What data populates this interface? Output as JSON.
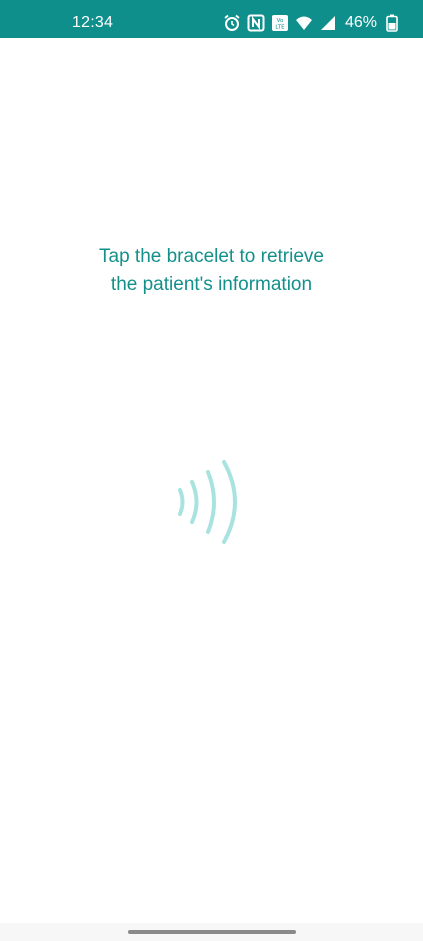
{
  "status_bar": {
    "time": "12:34",
    "battery": "46%",
    "icons": [
      "alarm-icon",
      "nfc-icon",
      "volte-icon",
      "wifi-icon",
      "signal-icon",
      "battery-icon"
    ],
    "background": "#0f8f8c"
  },
  "main": {
    "prompt_line1": "Tap the bracelet to retrieve",
    "prompt_line2": "the patient's information",
    "prompt_color": "#14908b",
    "illustration_icon": "contactless-waves-icon",
    "illustration_color": "#a9e3e0"
  },
  "nav_bar": {
    "handle": "gesture-home-bar"
  }
}
